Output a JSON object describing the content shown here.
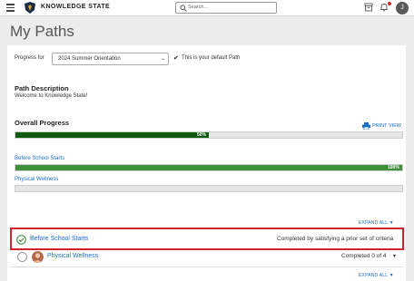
{
  "header": {
    "brand": "KNOWLEDGE STATE",
    "search_placeholder": "Search...",
    "avatar_initial": "J",
    "icons": [
      "menu-icon",
      "shield-logo-icon",
      "search-icon",
      "archive-icon",
      "bell-icon"
    ],
    "colors": {
      "notification": "#d12b2b"
    }
  },
  "page": {
    "title": "My Paths"
  },
  "progress_for": {
    "label": "Progress for",
    "selected": "2024 Summer Orientation",
    "default_note": "This is your default Path"
  },
  "path_description": {
    "heading": "Path Description",
    "text": "Welcome to Knowledge State!"
  },
  "overall_progress": {
    "heading": "Overall Progress",
    "print_label": "PRINT VIEW",
    "percent_label": "50%",
    "percent": 50,
    "color": "#0e5a0e"
  },
  "sections": [
    {
      "name": "Before School Starts",
      "percent_label": "100%",
      "percent": 100,
      "color": "#3f8f3f"
    },
    {
      "name": "Physical Wellness",
      "percent_label": "",
      "percent": 0,
      "color": "#3f8f3f"
    }
  ],
  "expand_label": "EXPAND ALL",
  "rows": [
    {
      "title": "Before School Starts",
      "status": "Completed by satisfying a prior set of criteria",
      "completed": true
    },
    {
      "title": "Physical Wellness",
      "status": "Completed 0 of 4",
      "completed": false
    }
  ],
  "colors": {
    "link": "#1a6ec7",
    "highlight_border": "#d2222d",
    "check_green": "#3f8f3f"
  }
}
